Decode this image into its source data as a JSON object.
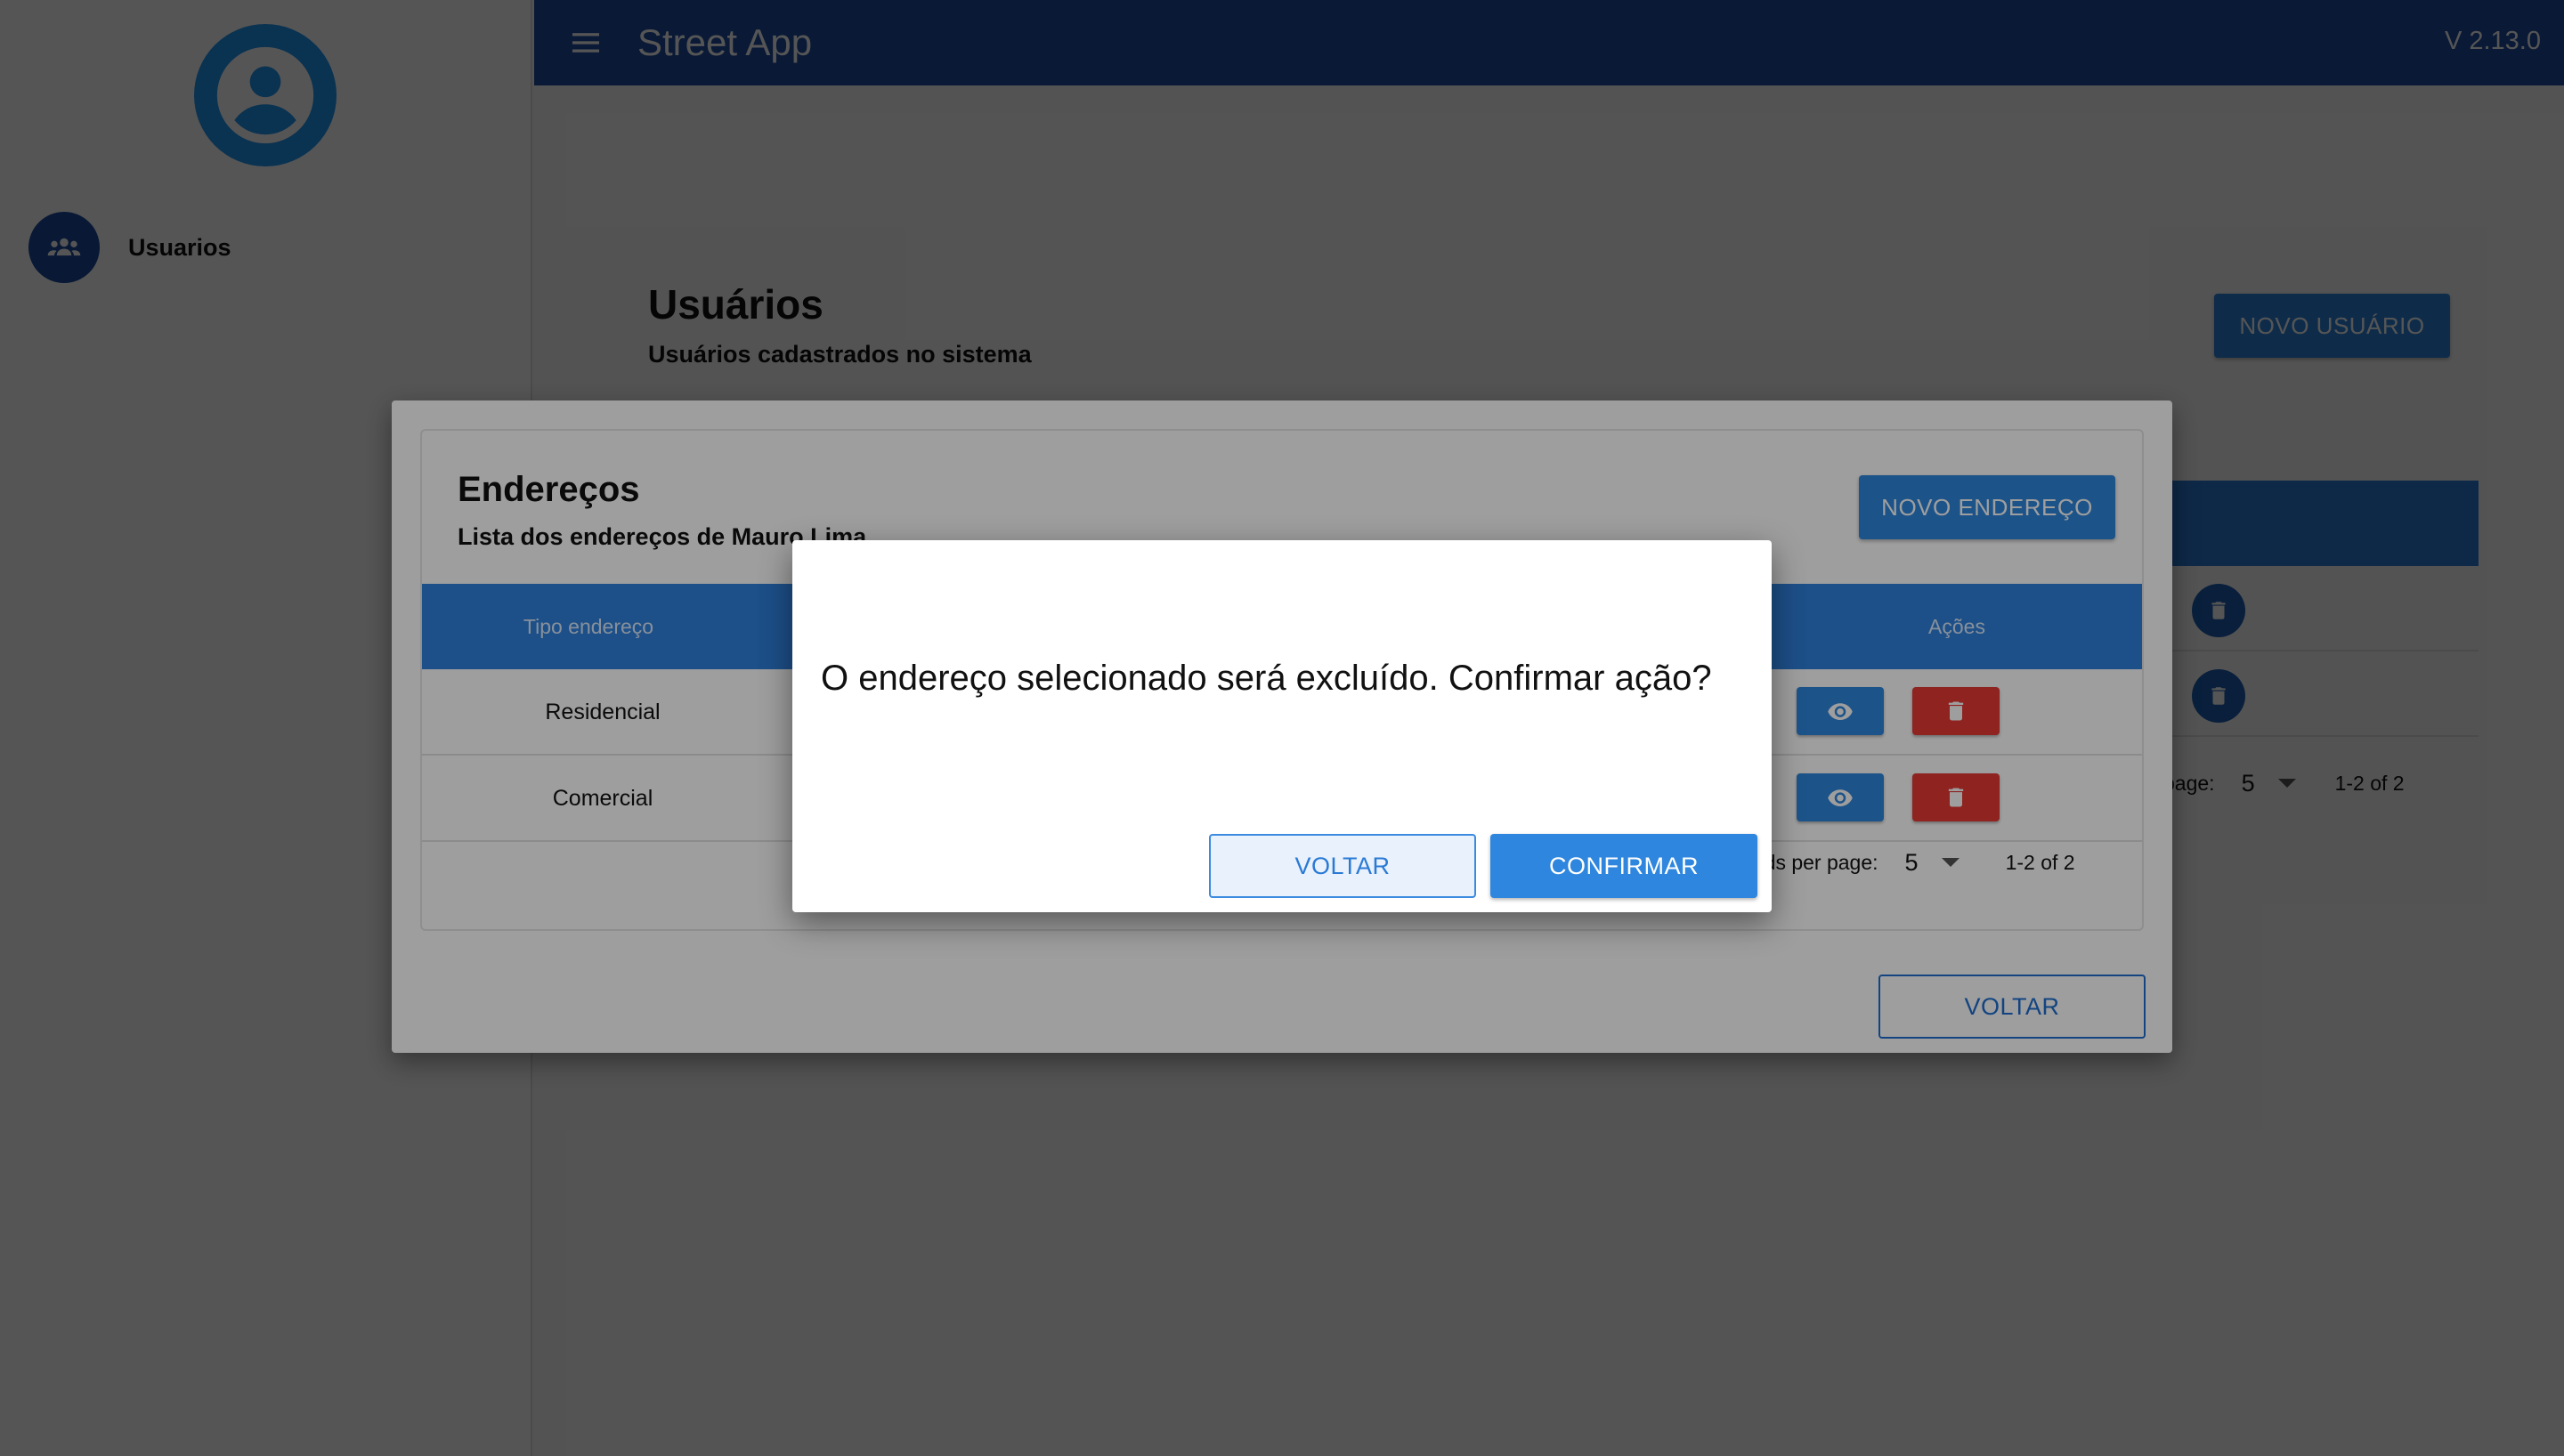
{
  "app": {
    "title": "Street App",
    "version": "V 2.13.0",
    "menu_icon": "menu-icon"
  },
  "sidebar": {
    "avatar_icon": "account-circle-icon",
    "items": [
      {
        "label": "Usuarios",
        "icon": "group-icon"
      }
    ]
  },
  "page": {
    "title": "Usuários",
    "subtitle": "Usuários cadastrados no sistema",
    "new_button": "NOVO USUÁRIO",
    "footer_rpp_label": "page:",
    "footer_rpp_value": "5",
    "footer_range": "1-2 of 2"
  },
  "address_dialog": {
    "title": "Endereços",
    "subtitle": "Lista dos endereços de Mauro Lima",
    "new_button": "NOVO ENDEREÇO",
    "columns": [
      "Tipo endereço",
      "Ações"
    ],
    "rows": [
      {
        "tipo": "Residencial"
      },
      {
        "tipo": "Comercial"
      }
    ],
    "footer": {
      "rpp_label": "rds per page:",
      "rpp_value": "5",
      "range": "1-2 of 2"
    },
    "back_button": "VOLTAR"
  },
  "confirm_dialog": {
    "message": "O endereço selecionado será excluído. Confirmar ação?",
    "cancel_button": "VOLTAR",
    "confirm_button": "CONFIRMAR"
  },
  "colors": {
    "primary": "#2e86de",
    "appbar": "#1c4da2",
    "danger": "#e53935"
  }
}
